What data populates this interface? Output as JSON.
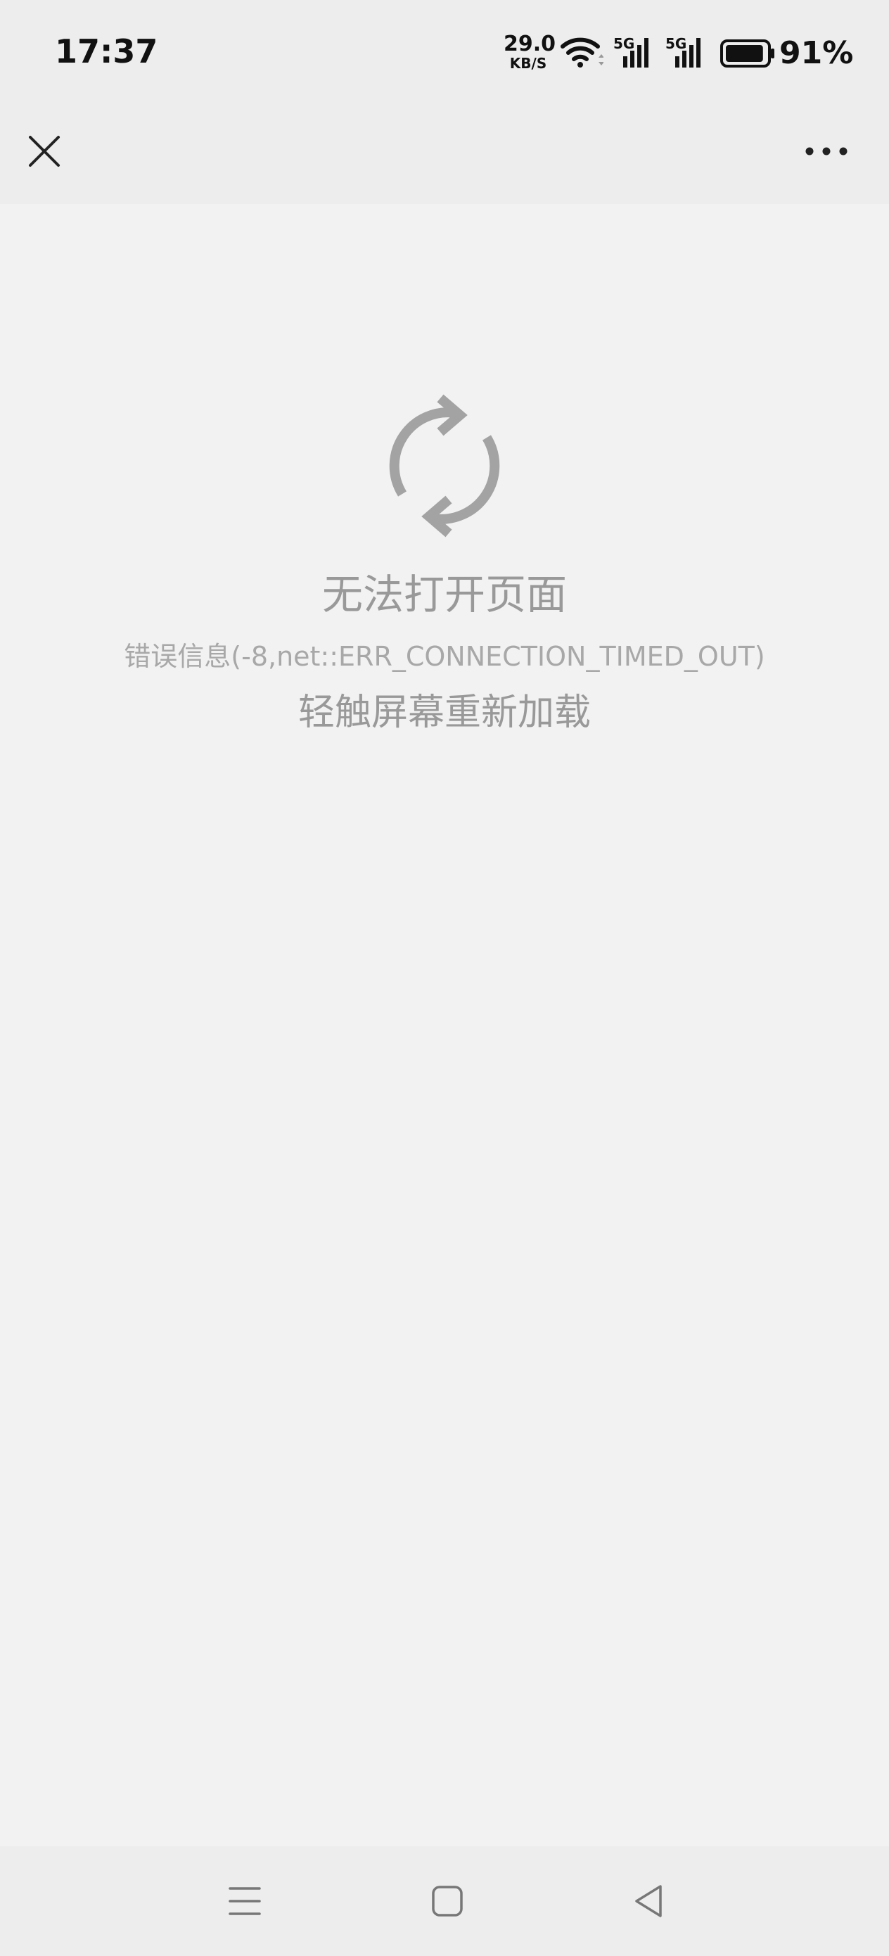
{
  "status_bar": {
    "time": "17:37",
    "net_speed_value": "29.0",
    "net_speed_unit": "KB/S",
    "sim1_label": "5G",
    "sim2_label": "5G",
    "battery_percent": "91%",
    "battery_level": 0.91,
    "icons": [
      "wifi-icon",
      "signal-icon",
      "signal-icon",
      "battery-icon"
    ]
  },
  "title_bar": {
    "close_icon": "close-icon",
    "more_icon": "more-icon"
  },
  "error": {
    "icon": "reload-icon",
    "title": "无法打开页面",
    "detail": "错误信息(-8,net::ERR_CONNECTION_TIMED_OUT)",
    "hint": "轻触屏幕重新加载"
  },
  "nav_bar": {
    "icons": [
      "menu-icon",
      "home-icon",
      "back-icon"
    ]
  },
  "colors": {
    "background": "#f2f2f2",
    "bars": "#ededed",
    "text_gray": "#999999",
    "icon_gray": "#a0a0a0"
  }
}
